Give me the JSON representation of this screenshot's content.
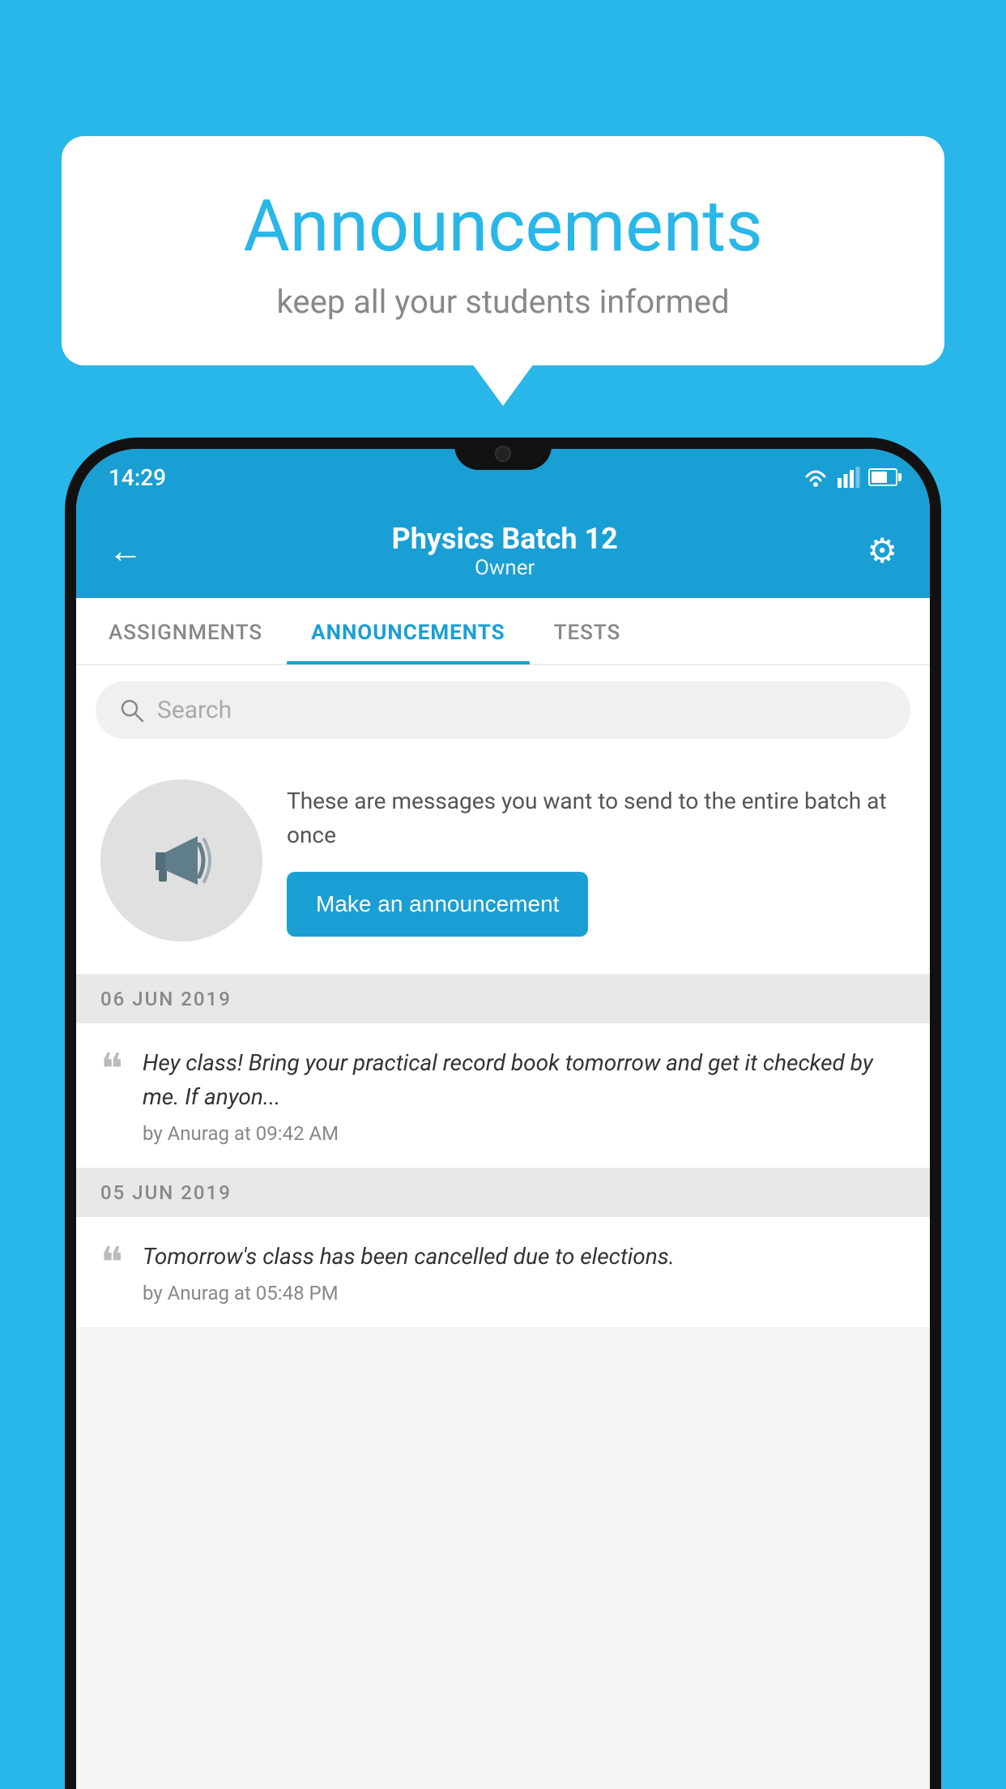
{
  "background_color": "#29B6E8",
  "speech_bubble": {
    "title": "Announcements",
    "subtitle": "keep all your students informed"
  },
  "status_bar": {
    "time": "14:29"
  },
  "header": {
    "title": "Physics Batch 12",
    "subtitle": "Owner",
    "back_label": "←",
    "gear_label": "⚙"
  },
  "tabs": [
    {
      "label": "ASSIGNMENTS",
      "active": false
    },
    {
      "label": "ANNOUNCEMENTS",
      "active": true
    },
    {
      "label": "TESTS",
      "active": false
    }
  ],
  "search": {
    "placeholder": "Search"
  },
  "promo": {
    "description": "These are messages you want to send to the entire batch at once",
    "button_label": "Make an announcement"
  },
  "announcements": [
    {
      "date": "06  JUN  2019",
      "text": "Hey class! Bring your practical record book tomorrow and get it checked by me. If anyon...",
      "meta": "by Anurag at 09:42 AM"
    },
    {
      "date": "05  JUN  2019",
      "text": "Tomorrow's class has been cancelled due to elections.",
      "meta": "by Anurag at 05:48 PM"
    }
  ]
}
